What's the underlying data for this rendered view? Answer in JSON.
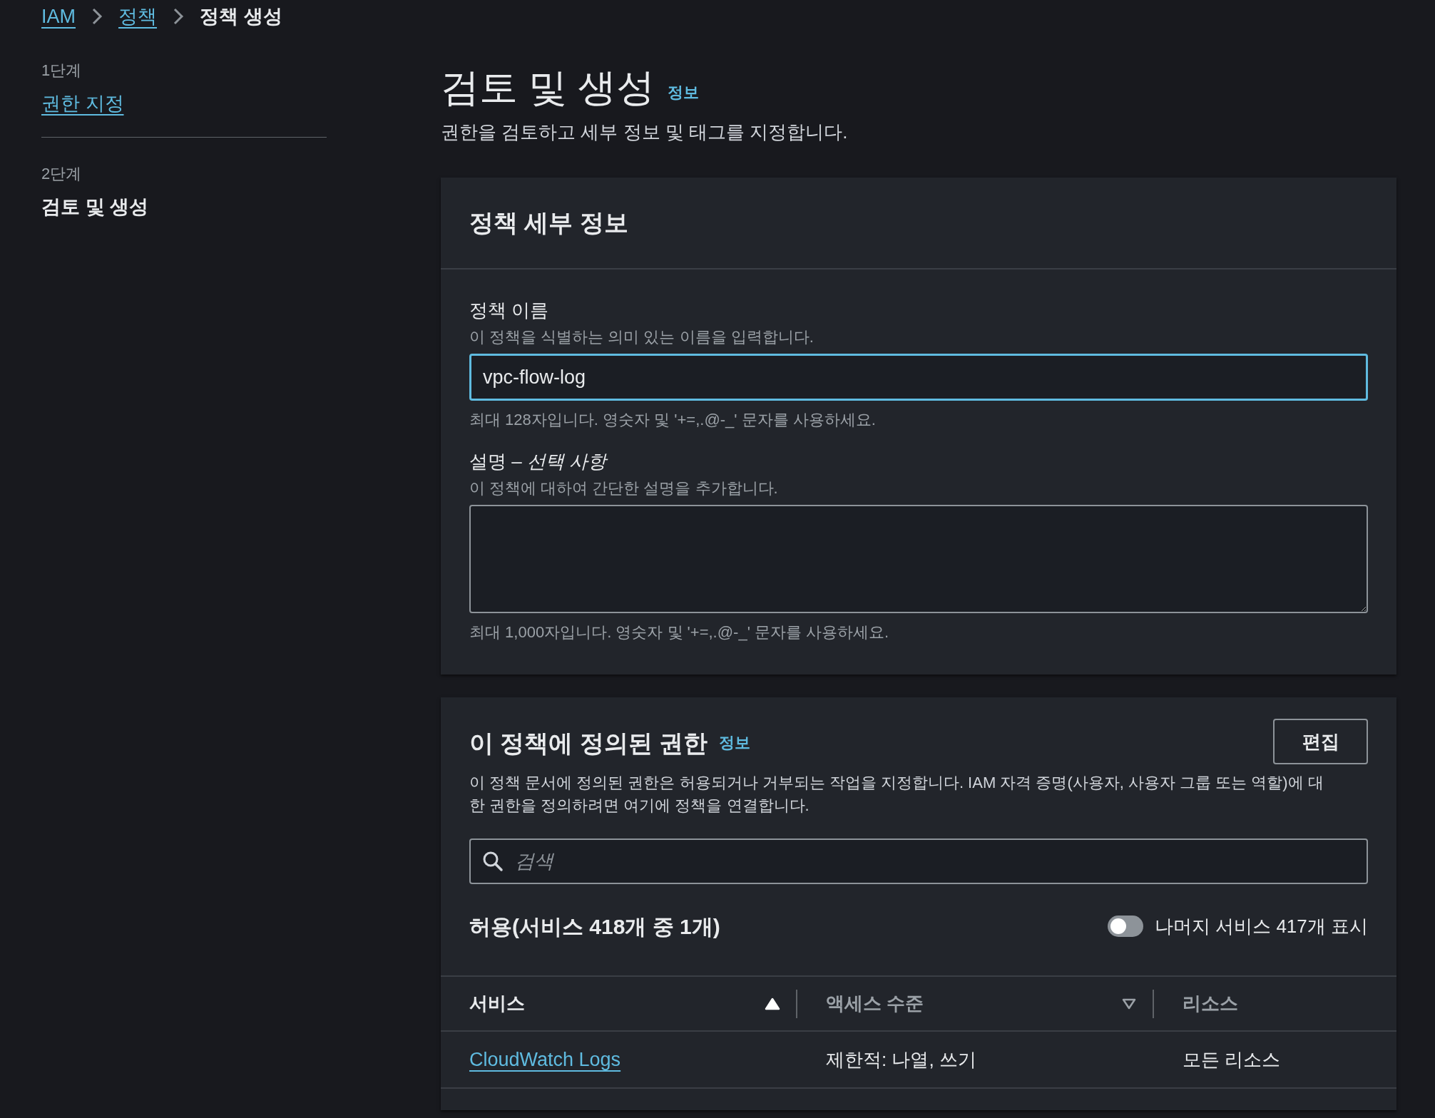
{
  "breadcrumb": [
    {
      "label": "IAM",
      "kind": "link"
    },
    {
      "label": "정책",
      "kind": "link"
    },
    {
      "label": "정책 생성",
      "kind": "current"
    }
  ],
  "steps": [
    {
      "step": "1단계",
      "label": "권한 지정",
      "selected": false
    },
    {
      "step": "2단계",
      "label": "검토 및 생성",
      "selected": true
    }
  ],
  "page": {
    "title": "검토 및 생성",
    "info": "정보",
    "subtitle": "권한을 검토하고 세부 정보 및 태그를 지정합니다."
  },
  "details_card": {
    "title": "정책 세부 정보",
    "name_field": {
      "label": "정책 이름",
      "hint": "이 정책을 식별하는 의미 있는 이름을 입력합니다.",
      "value": "vpc-flow-log",
      "focused": true,
      "constraint": "최대 128자입니다. 영숫자 및 '+=,.@-_' 문자를 사용하세요."
    },
    "description_field": {
      "label": "설명 – *선택 사항*",
      "hint": "이 정책에 대하여 간단한 설명을 추가합니다.",
      "focused": false,
      "constraint": "최대 1,000자입니다. 영숫자 및 '+=,.@-_' 문자를 사용하세요."
    }
  },
  "permissions_card": {
    "title": "이 정책에 정의된 권한",
    "info": "정보",
    "edit_button": "편집",
    "description": "이 정책 문서에 정의된 권한은 허용되거나 거부되는 작업을 지정합니다. IAM 자격 증명(사용자, 사용자 그룹 또는 역할)에 대한 권한을 정의하려면 여기에 정책을 연결합니다.",
    "search": {
      "placeholder": "검색"
    },
    "summary": "허용(서비스 418개 중 1개)",
    "toggle": {
      "label": "나머지 서비스 417개 표시",
      "on": false
    },
    "table": {
      "columns": [
        {
          "label": "서비스",
          "sorted": true,
          "kind": "ascending"
        },
        {
          "label": "액세스 수준",
          "sorted": false,
          "kind": "descending"
        },
        {
          "label": "리소스",
          "sorted": false,
          "kind": "plain"
        }
      ],
      "rows": [
        {
          "service": "CloudWatch Logs",
          "access": "제한적: 나열, 쓰기",
          "resource": "모든 리소스"
        }
      ]
    }
  }
}
